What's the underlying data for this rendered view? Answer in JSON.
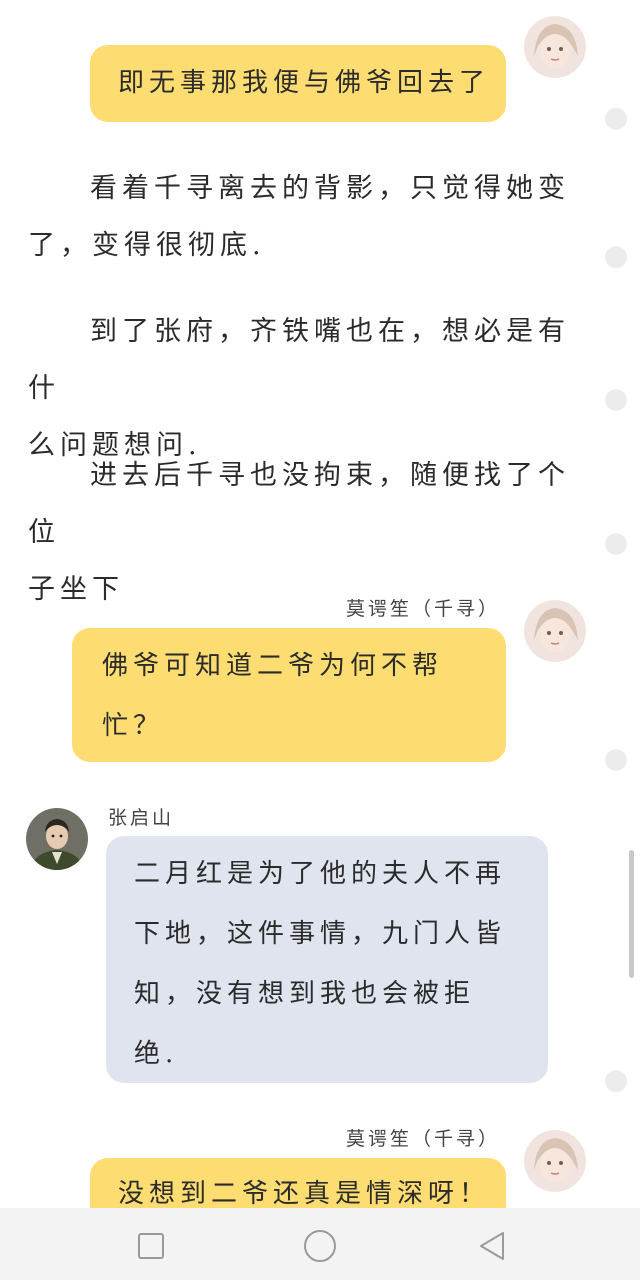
{
  "chat": {
    "messages": [
      {
        "sender": "",
        "side": "right",
        "text": "即无事那我便与佛爷回去了"
      },
      {
        "sender": "莫谔笙（千寻）",
        "side": "right",
        "text": "佛爷可知道二爷为何不帮忙？"
      },
      {
        "sender": "张启山",
        "side": "left",
        "text": "二月红是为了他的夫人不再下地，这件事情，九门人皆知，没有想到我也会被拒绝."
      },
      {
        "sender": "莫谔笙（千寻）",
        "side": "right",
        "text": "没想到二爷还真是情深呀！"
      }
    ],
    "msg2_lines": [
      "佛爷可知道二爷为何不帮",
      "忙？"
    ],
    "msg3_lines": [
      "二月红是为了他的夫人不再",
      "下地，这件事情，九门人皆",
      "知，没有想到我也会被拒",
      "绝."
    ]
  },
  "narration": [
    {
      "line1": "看着千寻离去的背影，只觉得她变",
      "line2": "了，变得很彻底."
    },
    {
      "line1": "到了张府，齐铁嘴也在，想必是有什",
      "line2": "么问题想问."
    },
    {
      "line1": "进去后千寻也没拘束，随便找了个位",
      "line2": "子坐下"
    }
  ],
  "navbar": {
    "recent_icon": "square-icon",
    "home_icon": "circle-icon",
    "back_icon": "triangle-back-icon"
  },
  "colors": {
    "self_bubble": "#fddd72",
    "other_bubble": "#dfe4ee",
    "navbar_bg": "#f3f3f3"
  }
}
